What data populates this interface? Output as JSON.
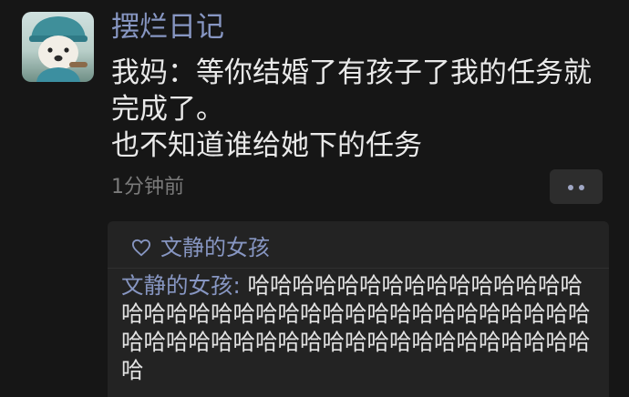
{
  "post": {
    "username": "摆烂日记",
    "lines": [
      "我妈：等你结婚了有孩子了我的任务就",
      "完成了。",
      "也不知道谁给她下的任务"
    ],
    "timestamp": "1分钟前"
  },
  "likes": {
    "icon": "heart-outline-icon",
    "name": "文静的女孩"
  },
  "comment": {
    "author": "文静的女孩",
    "separator": ": ",
    "text": "哈哈哈哈哈哈哈哈哈哈哈哈哈哈哈哈哈哈哈哈哈哈哈哈哈哈哈哈哈哈哈哈哈哈哈哈哈哈哈哈哈哈哈哈哈哈哈哈哈哈哈哈哈哈哈哈哈哈"
  },
  "colors": {
    "background": "#161616",
    "name_accent": "#8796c2",
    "text": "#e9e9e9",
    "muted": "#7a7a7a",
    "panel": "#232323"
  }
}
